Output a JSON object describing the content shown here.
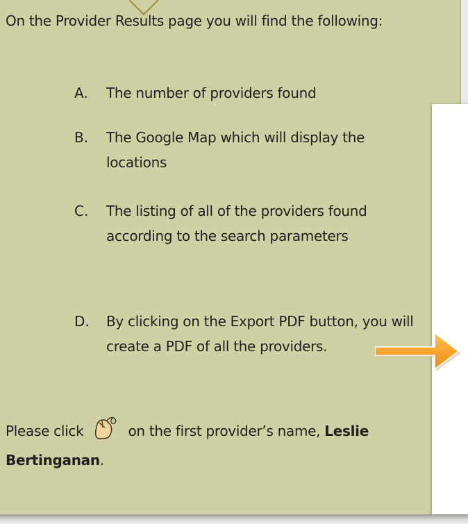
{
  "intro": "On the Provider Results page you will find the following:",
  "list": [
    {
      "letter": "A.",
      "text": "The number of providers found"
    },
    {
      "letter": "B.",
      "text": "The Google Map which will display the locations"
    },
    {
      "letter": "C.",
      "text": "The listing of all of the providers found according to the search parameters"
    },
    {
      "letter": "D.",
      "text": "By clicking on the Export PDF button, you will create a PDF of all the providers."
    }
  ],
  "instruction": {
    "before_icon": "Please click",
    "after_icon": "on the first provider’s name,",
    "provider_name": "Leslie Bertinganan",
    "end": "."
  },
  "icons": {
    "click": "mouse-icon",
    "pointer": "right-arrow-icon"
  },
  "colors": {
    "panel_background": "#cfd0a3",
    "arrow_fill": "#f39a1b"
  }
}
